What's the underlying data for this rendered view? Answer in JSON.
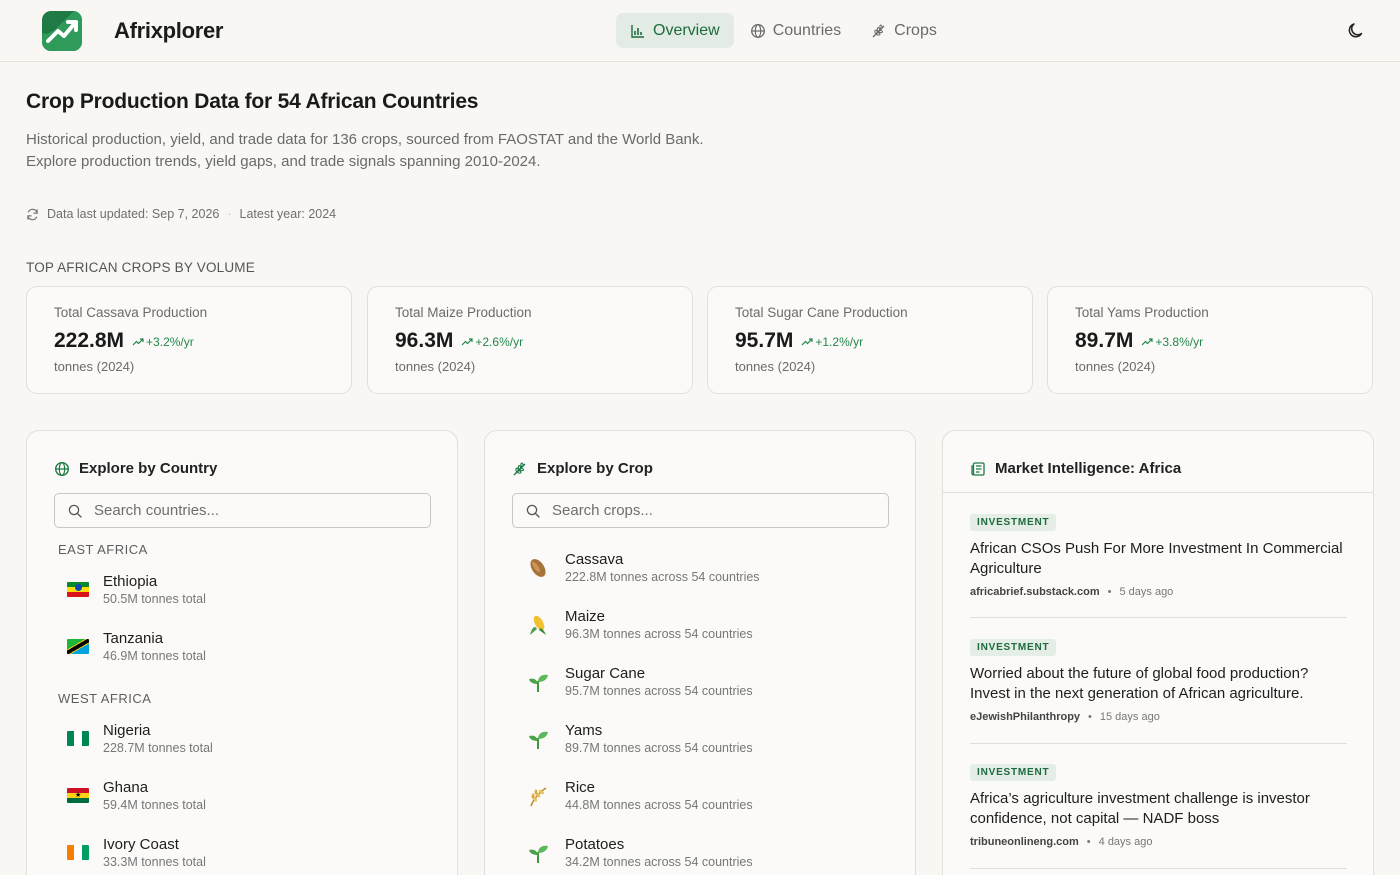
{
  "app": {
    "name": "Afrixplorer"
  },
  "nav": [
    {
      "label": "Overview",
      "icon": "bar-chart-icon",
      "active": true
    },
    {
      "label": "Countries",
      "icon": "globe-icon",
      "active": false
    },
    {
      "label": "Crops",
      "icon": "wheat-icon",
      "active": false
    }
  ],
  "header": {
    "title": "Crop Production Data for 54 African Countries",
    "subtitle_line1": "Historical production, yield, and trade data for 136 crops, sourced from FAOSTAT and the World Bank.",
    "subtitle_line2": "Explore production trends, yield gaps, and trade signals spanning 2010-2024.",
    "updated": "Data last updated: Sep 7, 2026",
    "separator": "·",
    "latest_year": "Latest year: 2024"
  },
  "top_crops": {
    "label": "TOP AFRICAN CROPS BY VOLUME",
    "cards": [
      {
        "label": "Total Cassava Production",
        "value": "222.8M",
        "change": "+3.2%/yr",
        "unit": "tonnes (2024)"
      },
      {
        "label": "Total Maize Production",
        "value": "96.3M",
        "change": "+2.6%/yr",
        "unit": "tonnes (2024)"
      },
      {
        "label": "Total Sugar Cane Production",
        "value": "95.7M",
        "change": "+1.2%/yr",
        "unit": "tonnes (2024)"
      },
      {
        "label": "Total Yams Production",
        "value": "89.7M",
        "change": "+3.8%/yr",
        "unit": "tonnes (2024)"
      }
    ]
  },
  "explore_country": {
    "title": "Explore by Country",
    "search_placeholder": "Search countries...",
    "regions": [
      {
        "name": "EAST AFRICA",
        "countries": [
          {
            "name": "Ethiopia",
            "total": "50.5M tonnes total"
          },
          {
            "name": "Tanzania",
            "total": "46.9M tonnes total"
          }
        ]
      },
      {
        "name": "WEST AFRICA",
        "countries": [
          {
            "name": "Nigeria",
            "total": "228.7M tonnes total"
          },
          {
            "name": "Ghana",
            "total": "59.4M tonnes total"
          },
          {
            "name": "Ivory Coast",
            "total": "33.3M tonnes total"
          }
        ]
      }
    ]
  },
  "explore_crop": {
    "title": "Explore by Crop",
    "search_placeholder": "Search crops...",
    "crops": [
      {
        "name": "Cassava",
        "meta": "222.8M tonnes across 54 countries",
        "icon": "cassava-icon"
      },
      {
        "name": "Maize",
        "meta": "96.3M tonnes across 54 countries",
        "icon": "maize-icon"
      },
      {
        "name": "Sugar Cane",
        "meta": "95.7M tonnes across 54 countries",
        "icon": "seedling-icon"
      },
      {
        "name": "Yams",
        "meta": "89.7M tonnes across 54 countries",
        "icon": "seedling-icon"
      },
      {
        "name": "Rice",
        "meta": "44.8M tonnes across 54 countries",
        "icon": "rice-icon"
      },
      {
        "name": "Potatoes",
        "meta": "34.2M tonnes across 54 countries",
        "icon": "seedling-icon"
      }
    ]
  },
  "market": {
    "title": "Market Intelligence: Africa",
    "news": [
      {
        "tag": "INVESTMENT",
        "title": "African CSOs Push For More Investment In Commercial Agriculture",
        "source": "africabrief.substack.com",
        "age": "5 days ago"
      },
      {
        "tag": "INVESTMENT",
        "title": "Worried about the future of global food production? Invest in the next generation of African agriculture.",
        "source": "eJewishPhilanthropy",
        "age": "15 days ago"
      },
      {
        "tag": "INVESTMENT",
        "title": "Africa’s agriculture investment challenge is investor confidence, not capital — NADF boss",
        "source": "tribuneonlineng.com",
        "age": "4 days ago"
      }
    ]
  },
  "colors": {
    "brand": "#1f7a45",
    "accent_bg": "#e3ebe5",
    "positive": "#23864b"
  }
}
